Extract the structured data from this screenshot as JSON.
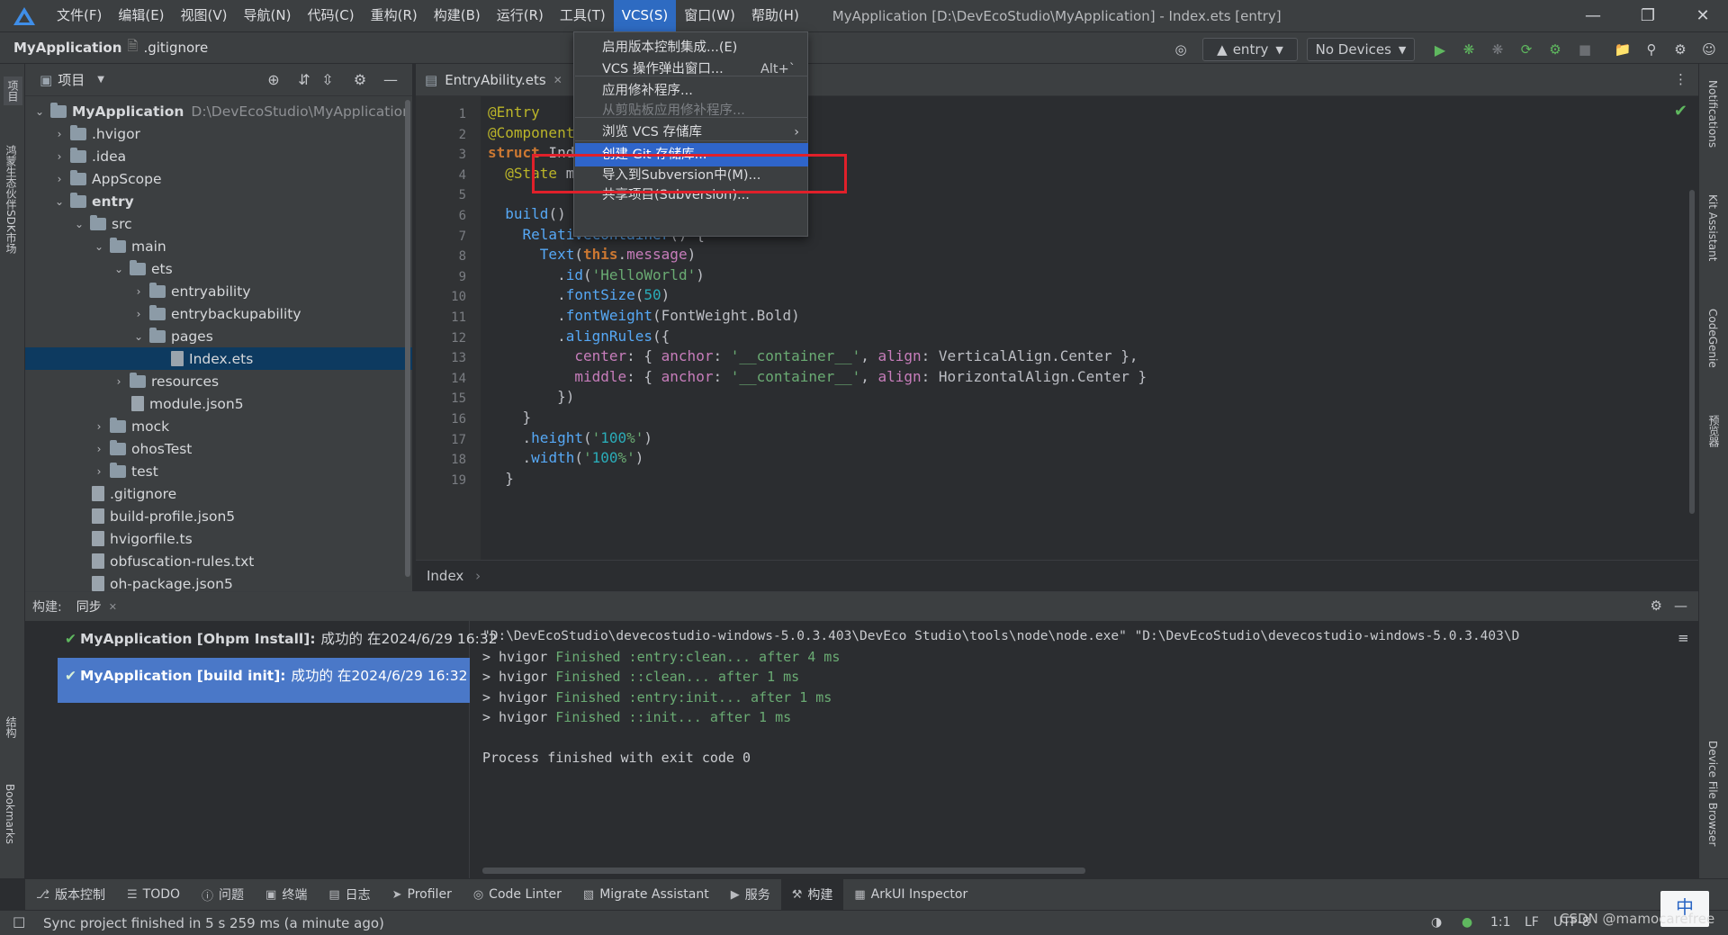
{
  "menubar": {
    "items": [
      "文件(F)",
      "编辑(E)",
      "视图(V)",
      "导航(N)",
      "代码(C)",
      "重构(R)",
      "构建(B)",
      "运行(R)",
      "工具(T)",
      "VCS(S)",
      "窗口(W)",
      "帮助(H)"
    ],
    "active_item": "VCS(S)",
    "window_title": "MyApplication [D:\\DevEcoStudio\\MyApplication] - Index.ets [entry]"
  },
  "navbar": {
    "project": "MyApplication",
    "file": ".gitignore",
    "run_config": "entry",
    "device": "No Devices"
  },
  "left_strip": {
    "tabs": [
      "项目",
      "鸿蒙生态伙伴SDK市场",
      "结构",
      "Bookmarks"
    ]
  },
  "right_strip": {
    "tabs": [
      "Notifications",
      "Kit Assistant",
      "CodeGenie",
      "预览器",
      "Device File Browser"
    ]
  },
  "project_panel": {
    "title": "项目",
    "root_path": "D:\\DevEcoStudio\\MyApplication",
    "tree": [
      {
        "label": "MyApplication",
        "kind": "folder",
        "chevron": "down",
        "bold": true
      },
      {
        "label": ".hvigor",
        "kind": "folder",
        "chevron": "right"
      },
      {
        "label": ".idea",
        "kind": "folder",
        "chevron": "right"
      },
      {
        "label": "AppScope",
        "kind": "folder",
        "chevron": "right"
      },
      {
        "label": "entry",
        "kind": "folder",
        "chevron": "down",
        "bold": true
      },
      {
        "label": "src",
        "kind": "folder",
        "chevron": "down"
      },
      {
        "label": "main",
        "kind": "folder",
        "chevron": "down"
      },
      {
        "label": "ets",
        "kind": "folder",
        "chevron": "down"
      },
      {
        "label": "entryability",
        "kind": "folder",
        "chevron": "right"
      },
      {
        "label": "entrybackupability",
        "kind": "folder",
        "chevron": "right"
      },
      {
        "label": "pages",
        "kind": "folder",
        "chevron": "down"
      },
      {
        "label": "Index.ets",
        "kind": "file",
        "chevron": "",
        "selected": true
      },
      {
        "label": "resources",
        "kind": "folder",
        "chevron": "right"
      },
      {
        "label": "module.json5",
        "kind": "file",
        "chevron": ""
      },
      {
        "label": "mock",
        "kind": "folder",
        "chevron": "right"
      },
      {
        "label": "ohosTest",
        "kind": "folder",
        "chevron": "right"
      },
      {
        "label": "test",
        "kind": "folder",
        "chevron": "right"
      },
      {
        "label": ".gitignore",
        "kind": "file",
        "chevron": ""
      },
      {
        "label": "build-profile.json5",
        "kind": "file",
        "chevron": ""
      },
      {
        "label": "hvigorfile.ts",
        "kind": "file",
        "chevron": ""
      },
      {
        "label": "obfuscation-rules.txt",
        "kind": "file",
        "chevron": ""
      },
      {
        "label": "oh-package.json5",
        "kind": "file",
        "chevron": ""
      }
    ],
    "indent_levels": [
      0,
      1,
      1,
      1,
      1,
      2,
      3,
      4,
      5,
      5,
      5,
      6,
      4,
      4,
      3,
      3,
      3,
      2,
      2,
      2,
      2,
      2
    ]
  },
  "editor": {
    "tab_label": "EntryAbility.ets",
    "breadcrumb": "Index",
    "line_numbers": [
      "1",
      "2",
      "3",
      "4",
      "5",
      "6",
      "7",
      "8",
      "9",
      "10",
      "11",
      "12",
      "13",
      "14",
      "15",
      "16",
      "17",
      "18",
      "19"
    ],
    "lines": [
      "@Entry",
      "@Component",
      "struct Ind",
      "  @State m",
      "",
      "  build() {",
      "    RelativeContainer() {",
      "      Text(this.message)",
      "        .id('HelloWorld')",
      "        .fontSize(50)",
      "        .fontWeight(FontWeight.Bold)",
      "        .alignRules({",
      "          center: { anchor: '__container__', align: VerticalAlign.Center },",
      "          middle: { anchor: '__container__', align: HorizontalAlign.Center }",
      "        })",
      "    }",
      "    .height('100%')",
      "    .width('100%')",
      "  }"
    ],
    "line4_tail": "rld';"
  },
  "vcs_menu": {
    "items": [
      {
        "label": "启用版本控制集成...(E)",
        "shortcut": "",
        "disabled": false
      },
      {
        "label": "VCS 操作弹出窗口...",
        "shortcut": "Alt+`",
        "disabled": false
      },
      {
        "label": "应用修补程序...",
        "shortcut": "",
        "disabled": false
      },
      {
        "label": "从剪贴板应用修补程序...",
        "shortcut": "",
        "disabled": true
      },
      {
        "label": "浏览 VCS 存储库",
        "shortcut": "",
        "disabled": false,
        "submenu": true
      },
      {
        "label": "创建 Git 存储库...",
        "shortcut": "",
        "disabled": false,
        "highlight": true
      },
      {
        "label": "导入到Subversion中(M)...",
        "shortcut": "",
        "disabled": false
      },
      {
        "label": "共享项目(Subversion)...",
        "shortcut": "",
        "disabled": false
      }
    ]
  },
  "build_panel": {
    "label": "构建:",
    "tab": "同步",
    "rows": [
      {
        "title": "MyApplication [Ohpm Install]:",
        "detail": "成功的 在2024/6/29 16:32"
      },
      {
        "title": "MyApplication [build init]:",
        "detail": "成功的 在2024/6/29 16:32"
      }
    ],
    "console": [
      {
        "prefix": "\"D:\\DevEcoStudio\\devecostudio-windows-5.0.3.403\\DevEco Studio\\tools\\node\\node.exe\" \"D:\\DevEcoStudio\\devecostudio-windows-5.0.3.403\\D",
        "ok": "",
        "rest": ""
      },
      {
        "prefix": "> hvigor ",
        "ok": "Finished :entry:clean... after 4 ms",
        "rest": ""
      },
      {
        "prefix": "> hvigor ",
        "ok": "Finished ::clean... after 1 ms",
        "rest": ""
      },
      {
        "prefix": "> hvigor ",
        "ok": "Finished :entry:init... after 1 ms",
        "rest": ""
      },
      {
        "prefix": "> hvigor ",
        "ok": "Finished ::init... after 1 ms",
        "rest": ""
      },
      {
        "prefix": "",
        "ok": "",
        "rest": ""
      },
      {
        "prefix": "Process finished with exit code 0",
        "ok": "",
        "rest": ""
      }
    ]
  },
  "bottom_tabs": [
    {
      "label": "版本控制",
      "icon": "branch-icon"
    },
    {
      "label": "TODO",
      "icon": "list-icon"
    },
    {
      "label": "问题",
      "icon": "info-icon"
    },
    {
      "label": "终端",
      "icon": "terminal-icon"
    },
    {
      "label": "日志",
      "icon": "log-icon"
    },
    {
      "label": "Profiler",
      "icon": "profiler-icon"
    },
    {
      "label": "Code Linter",
      "icon": "linter-icon"
    },
    {
      "label": "Migrate Assistant",
      "icon": "migrate-icon"
    },
    {
      "label": "服务",
      "icon": "service-icon"
    },
    {
      "label": "构建",
      "icon": "hammer-icon",
      "active": true
    },
    {
      "label": "ArkUI Inspector",
      "icon": "inspector-icon"
    }
  ],
  "statusbar": {
    "message": "Sync project finished in 5 s 259 ms (a minute ago)",
    "position": "1:1",
    "line_sep": "LF",
    "encoding": "UTF-8",
    "ime": "中",
    "watermark": "CSDN @mamocarefree"
  },
  "colors": {
    "accent": "#2f65ca",
    "annotation": "#e0202a",
    "success": "#5fb85f"
  }
}
